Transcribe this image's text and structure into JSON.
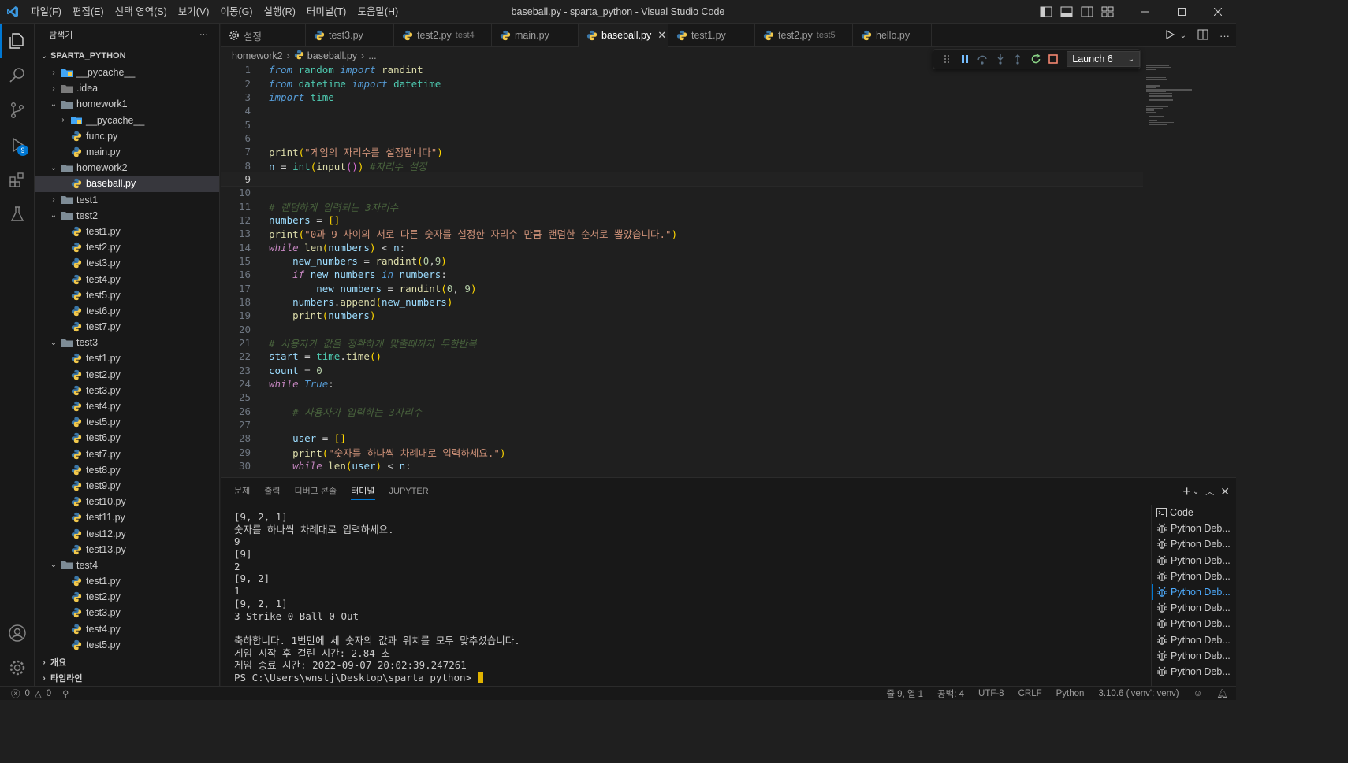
{
  "window": {
    "title": "baseball.py - sparta_python - Visual Studio Code",
    "menu": [
      "파일(F)",
      "편집(E)",
      "선택 영역(S)",
      "보기(V)",
      "이동(G)",
      "실행(R)",
      "터미널(T)",
      "도움말(H)"
    ]
  },
  "activity_bar": {
    "debug_badge": "9"
  },
  "sidebar": {
    "title": "탐색기",
    "more": "···",
    "root": "SPARTA_PYTHON",
    "items": [
      {
        "label": "__pycache__",
        "type": "folder-py",
        "level": 1,
        "expanded": false
      },
      {
        "label": ".idea",
        "type": "folder-idea",
        "level": 1,
        "expanded": false
      },
      {
        "label": "homework1",
        "type": "folder",
        "level": 1,
        "expanded": true
      },
      {
        "label": "__pycache__",
        "type": "folder-py",
        "level": 2,
        "expanded": false
      },
      {
        "label": "func.py",
        "type": "py",
        "level": 2
      },
      {
        "label": "main.py",
        "type": "py",
        "level": 2
      },
      {
        "label": "homework2",
        "type": "folder",
        "level": 1,
        "expanded": true
      },
      {
        "label": "baseball.py",
        "type": "py",
        "level": 2,
        "selected": true
      },
      {
        "label": "test1",
        "type": "folder",
        "level": 1,
        "expanded": false
      },
      {
        "label": "test2",
        "type": "folder",
        "level": 1,
        "expanded": true
      },
      {
        "label": "test1.py",
        "type": "py",
        "level": 2
      },
      {
        "label": "test2.py",
        "type": "py",
        "level": 2
      },
      {
        "label": "test3.py",
        "type": "py",
        "level": 2
      },
      {
        "label": "test4.py",
        "type": "py",
        "level": 2
      },
      {
        "label": "test5.py",
        "type": "py",
        "level": 2
      },
      {
        "label": "test6.py",
        "type": "py",
        "level": 2
      },
      {
        "label": "test7.py",
        "type": "py",
        "level": 2
      },
      {
        "label": "test3",
        "type": "folder",
        "level": 1,
        "expanded": true
      },
      {
        "label": "test1.py",
        "type": "py",
        "level": 2
      },
      {
        "label": "test2.py",
        "type": "py",
        "level": 2
      },
      {
        "label": "test3.py",
        "type": "py",
        "level": 2
      },
      {
        "label": "test4.py",
        "type": "py",
        "level": 2
      },
      {
        "label": "test5.py",
        "type": "py",
        "level": 2
      },
      {
        "label": "test6.py",
        "type": "py",
        "level": 2
      },
      {
        "label": "test7.py",
        "type": "py",
        "level": 2
      },
      {
        "label": "test8.py",
        "type": "py",
        "level": 2
      },
      {
        "label": "test9.py",
        "type": "py",
        "level": 2
      },
      {
        "label": "test10.py",
        "type": "py",
        "level": 2
      },
      {
        "label": "test11.py",
        "type": "py",
        "level": 2
      },
      {
        "label": "test12.py",
        "type": "py",
        "level": 2
      },
      {
        "label": "test13.py",
        "type": "py",
        "level": 2
      },
      {
        "label": "test4",
        "type": "folder",
        "level": 1,
        "expanded": true
      },
      {
        "label": "test1.py",
        "type": "py",
        "level": 2
      },
      {
        "label": "test2.py",
        "type": "py",
        "level": 2
      },
      {
        "label": "test3.py",
        "type": "py",
        "level": 2
      },
      {
        "label": "test4.py",
        "type": "py",
        "level": 2
      },
      {
        "label": "test5.py",
        "type": "py",
        "level": 2
      }
    ],
    "footer": [
      "개요",
      "타임라인"
    ]
  },
  "tabs": [
    {
      "label": "설정",
      "desc": "",
      "icon": "settings-icon"
    },
    {
      "label": "test3.py",
      "desc": "",
      "icon": "python-icon"
    },
    {
      "label": "test2.py",
      "desc": "test4",
      "icon": "python-icon"
    },
    {
      "label": "main.py",
      "desc": "",
      "icon": "python-icon"
    },
    {
      "label": "baseball.py",
      "desc": "",
      "icon": "python-icon",
      "active": true
    },
    {
      "label": "test1.py",
      "desc": "",
      "icon": "python-icon"
    },
    {
      "label": "test2.py",
      "desc": "test5",
      "icon": "python-icon"
    },
    {
      "label": "hello.py",
      "desc": "",
      "icon": "python-icon"
    }
  ],
  "breadcrumb": [
    "homework2",
    "baseball.py",
    "..."
  ],
  "debug": {
    "config": "Launch 6"
  },
  "editor": {
    "current_line": 9,
    "lines": [
      [
        [
          "kw",
          "from"
        ],
        [
          "t",
          " "
        ],
        [
          "mod",
          "random"
        ],
        [
          "t",
          " "
        ],
        [
          "kw",
          "import"
        ],
        [
          "t",
          " "
        ],
        [
          "fn",
          "randint"
        ]
      ],
      [
        [
          "kw",
          "from"
        ],
        [
          "t",
          " "
        ],
        [
          "mod",
          "datetime"
        ],
        [
          "t",
          " "
        ],
        [
          "kw",
          "import"
        ],
        [
          "t",
          " "
        ],
        [
          "mod",
          "datetime"
        ]
      ],
      [
        [
          "kw",
          "import"
        ],
        [
          "t",
          " "
        ],
        [
          "mod",
          "time"
        ]
      ],
      [],
      [],
      [],
      [
        [
          "fn",
          "print"
        ],
        [
          "br",
          "("
        ],
        [
          "str",
          "\"게임의 자리수를 설정합니다\""
        ],
        [
          "br",
          ")"
        ]
      ],
      [
        [
          "var",
          "n"
        ],
        [
          "t",
          " = "
        ],
        [
          "bi",
          "int"
        ],
        [
          "br",
          "("
        ],
        [
          "fn",
          "input"
        ],
        [
          "br2",
          "()"
        ],
        [
          "br",
          ")"
        ],
        [
          "t",
          " "
        ],
        [
          "cm",
          "#자리수 설정"
        ]
      ],
      [],
      [],
      [
        [
          "cm",
          "# 랜덤하게 입력되는 3자리수"
        ]
      ],
      [
        [
          "var",
          "numbers"
        ],
        [
          "t",
          " = "
        ],
        [
          "br",
          "[]"
        ]
      ],
      [
        [
          "fn",
          "print"
        ],
        [
          "br",
          "("
        ],
        [
          "str",
          "\"0과 9 사이의 서로 다른 숫자를 설정한 자리수 만큼 랜덤한 순서로 뽑았습니다.\""
        ],
        [
          "br",
          ")"
        ]
      ],
      [
        [
          "kw2",
          "while"
        ],
        [
          "t",
          " "
        ],
        [
          "fn",
          "len"
        ],
        [
          "br",
          "("
        ],
        [
          "var",
          "numbers"
        ],
        [
          "br",
          ")"
        ],
        [
          "t",
          " < "
        ],
        [
          "var",
          "n"
        ],
        [
          "t",
          ":"
        ]
      ],
      [
        [
          "t",
          "    "
        ],
        [
          "var",
          "new_numbers"
        ],
        [
          "t",
          " = "
        ],
        [
          "fn",
          "randint"
        ],
        [
          "br",
          "("
        ],
        [
          "num",
          "0"
        ],
        [
          "t",
          ","
        ],
        [
          "num",
          "9"
        ],
        [
          "br",
          ")"
        ]
      ],
      [
        [
          "t",
          "    "
        ],
        [
          "kw2",
          "if"
        ],
        [
          "t",
          " "
        ],
        [
          "var",
          "new_numbers"
        ],
        [
          "t",
          " "
        ],
        [
          "kw",
          "in"
        ],
        [
          "t",
          " "
        ],
        [
          "var",
          "numbers"
        ],
        [
          "t",
          ":"
        ]
      ],
      [
        [
          "t",
          "        "
        ],
        [
          "var",
          "new_numbers"
        ],
        [
          "t",
          " = "
        ],
        [
          "fn",
          "randint"
        ],
        [
          "br",
          "("
        ],
        [
          "num",
          "0"
        ],
        [
          "t",
          ", "
        ],
        [
          "num",
          "9"
        ],
        [
          "br",
          ")"
        ]
      ],
      [
        [
          "t",
          "    "
        ],
        [
          "var",
          "numbers"
        ],
        [
          "t",
          "."
        ],
        [
          "fn",
          "append"
        ],
        [
          "br",
          "("
        ],
        [
          "var",
          "new_numbers"
        ],
        [
          "br",
          ")"
        ]
      ],
      [
        [
          "t",
          "    "
        ],
        [
          "fn",
          "print"
        ],
        [
          "br",
          "("
        ],
        [
          "var",
          "numbers"
        ],
        [
          "br",
          ")"
        ]
      ],
      [],
      [
        [
          "cm",
          "# 사용자가 값을 정확하게 맞출때까지 무한반복"
        ]
      ],
      [
        [
          "var",
          "start"
        ],
        [
          "t",
          " = "
        ],
        [
          "mod",
          "time"
        ],
        [
          "t",
          "."
        ],
        [
          "fn",
          "time"
        ],
        [
          "br",
          "()"
        ]
      ],
      [
        [
          "var",
          "count"
        ],
        [
          "t",
          " = "
        ],
        [
          "num",
          "0"
        ]
      ],
      [
        [
          "kw2",
          "while"
        ],
        [
          "t",
          " "
        ],
        [
          "kw",
          "True"
        ],
        [
          "t",
          ":"
        ]
      ],
      [],
      [
        [
          "t",
          "    "
        ],
        [
          "cm",
          "# 사용자가 입력하는 3자리수"
        ]
      ],
      [],
      [
        [
          "t",
          "    "
        ],
        [
          "var",
          "user"
        ],
        [
          "t",
          " = "
        ],
        [
          "br",
          "[]"
        ]
      ],
      [
        [
          "t",
          "    "
        ],
        [
          "fn",
          "print"
        ],
        [
          "br",
          "("
        ],
        [
          "str",
          "\"숫자를 하나씩 차례대로 입력하세요.\""
        ],
        [
          "br",
          ")"
        ]
      ],
      [
        [
          "t",
          "    "
        ],
        [
          "kw2",
          "while"
        ],
        [
          "t",
          " "
        ],
        [
          "fn",
          "len"
        ],
        [
          "br",
          "("
        ],
        [
          "var",
          "user"
        ],
        [
          "br",
          ")"
        ],
        [
          "t",
          " < "
        ],
        [
          "var",
          "n"
        ],
        [
          "t",
          ":"
        ]
      ]
    ]
  },
  "panel": {
    "tabs": [
      "문제",
      "출력",
      "디버그 콘솔",
      "터미널",
      "JUPYTER"
    ],
    "active_tab": "터미널",
    "terminal_lines": [
      "[9, 2, 1]",
      "숫자를 하나씩 차례대로 입력하세요.",
      "9",
      "[9]",
      "2",
      "[9, 2]",
      "1",
      "[9, 2, 1]",
      "3 Strike 0 Ball 0 Out",
      "",
      "축하합니다. 1번만에 세 숫자의 값과 위치를 모두 맞추셨습니다.",
      "게임 시작 후 걸린 시간: 2.84 초",
      "게임 종료 시간: 2022-09-07 20:02:39.247261"
    ],
    "prompt": "PS C:\\Users\\wnstj\\Desktop\\sparta_python> ",
    "terminal_list": [
      {
        "label": "Code",
        "icon": "terminal-icon"
      },
      {
        "label": "Python Deb...",
        "icon": "debug-icon"
      },
      {
        "label": "Python Deb...",
        "icon": "debug-icon"
      },
      {
        "label": "Python Deb...",
        "icon": "debug-icon"
      },
      {
        "label": "Python Deb...",
        "icon": "debug-icon"
      },
      {
        "label": "Python Deb...",
        "icon": "debug-icon",
        "active": true
      },
      {
        "label": "Python Deb...",
        "icon": "debug-icon"
      },
      {
        "label": "Python Deb...",
        "icon": "debug-icon"
      },
      {
        "label": "Python Deb...",
        "icon": "debug-icon"
      },
      {
        "label": "Python Deb...",
        "icon": "debug-icon"
      },
      {
        "label": "Python Deb...",
        "icon": "debug-icon"
      }
    ]
  },
  "statusbar": {
    "errors": "0",
    "warnings": "0",
    "position": "줄 9, 열 1",
    "spaces": "공백: 4",
    "encoding": "UTF-8",
    "eol": "CRLF",
    "language": "Python",
    "interpreter": "3.10.6 ('venv': venv)"
  },
  "colors": {
    "accent": "#0078d4",
    "background": "#1f1f1f",
    "sidebar": "#181818"
  }
}
